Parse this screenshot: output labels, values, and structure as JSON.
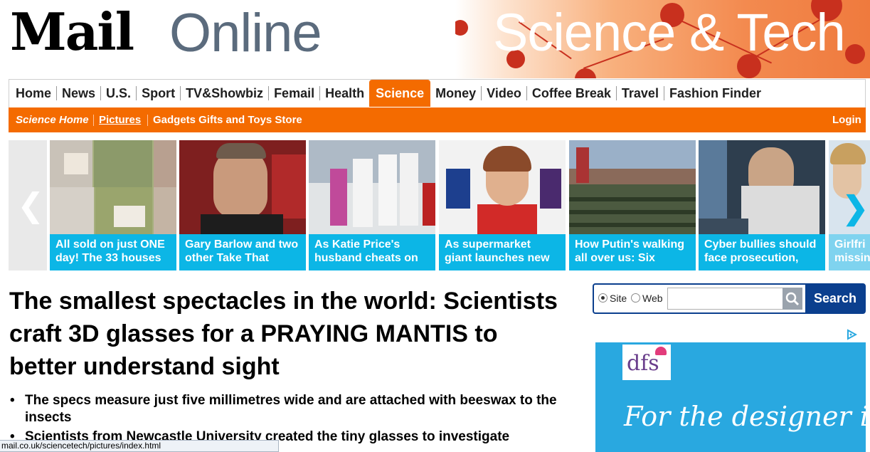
{
  "header": {
    "logo_mail": "Mail",
    "logo_online": "Online",
    "section_banner": "Science & Tech"
  },
  "nav": {
    "items": [
      {
        "label": "Home"
      },
      {
        "label": "News"
      },
      {
        "label": "U.S."
      },
      {
        "label": "Sport"
      },
      {
        "label": "TV&Showbiz"
      },
      {
        "label": "Femail"
      },
      {
        "label": "Health"
      },
      {
        "label": "Science",
        "active": true
      },
      {
        "label": "Money"
      },
      {
        "label": "Video"
      },
      {
        "label": "Coffee Break"
      },
      {
        "label": "Travel"
      },
      {
        "label": "Fashion Finder"
      }
    ]
  },
  "subnav": {
    "items": [
      {
        "label": "Science Home"
      },
      {
        "label": "Pictures"
      },
      {
        "label": "Gadgets Gifts and Toys Store"
      }
    ],
    "login": "Login"
  },
  "carousel": {
    "tiles": [
      {
        "caption": "All sold on just ONE day! The 33 houses"
      },
      {
        "caption": "Gary Barlow and two other Take That"
      },
      {
        "caption": "As Katie Price's husband cheats on"
      },
      {
        "caption": "As supermarket giant launches new"
      },
      {
        "caption": "How Putin's walking all over us: Six"
      },
      {
        "caption": "Cyber bullies should face prosecution,"
      },
      {
        "caption": "Girlfri missin"
      }
    ]
  },
  "article": {
    "headline": "The smallest spectacles in the world: Scientists craft 3D glasses for a PRAYING MANTIS to better understand sight",
    "bullets": [
      "The specs measure just five millimetres wide and are attached with beeswax to the insects",
      "Scientists from Newcastle University created the tiny glasses to investigate"
    ]
  },
  "search": {
    "options": [
      "Site",
      "Web"
    ],
    "selected": "Site",
    "value": "",
    "button_label": "Search"
  },
  "ad": {
    "brand": "dfs",
    "tagline": "For the designer in you"
  },
  "statusbar": {
    "url": "mail.co.uk/sciencetech/pictures/index.html"
  },
  "colors": {
    "orange": "#f46b00",
    "caption_blue": "#0cb6e6",
    "search_navy": "#0b3f8e"
  }
}
